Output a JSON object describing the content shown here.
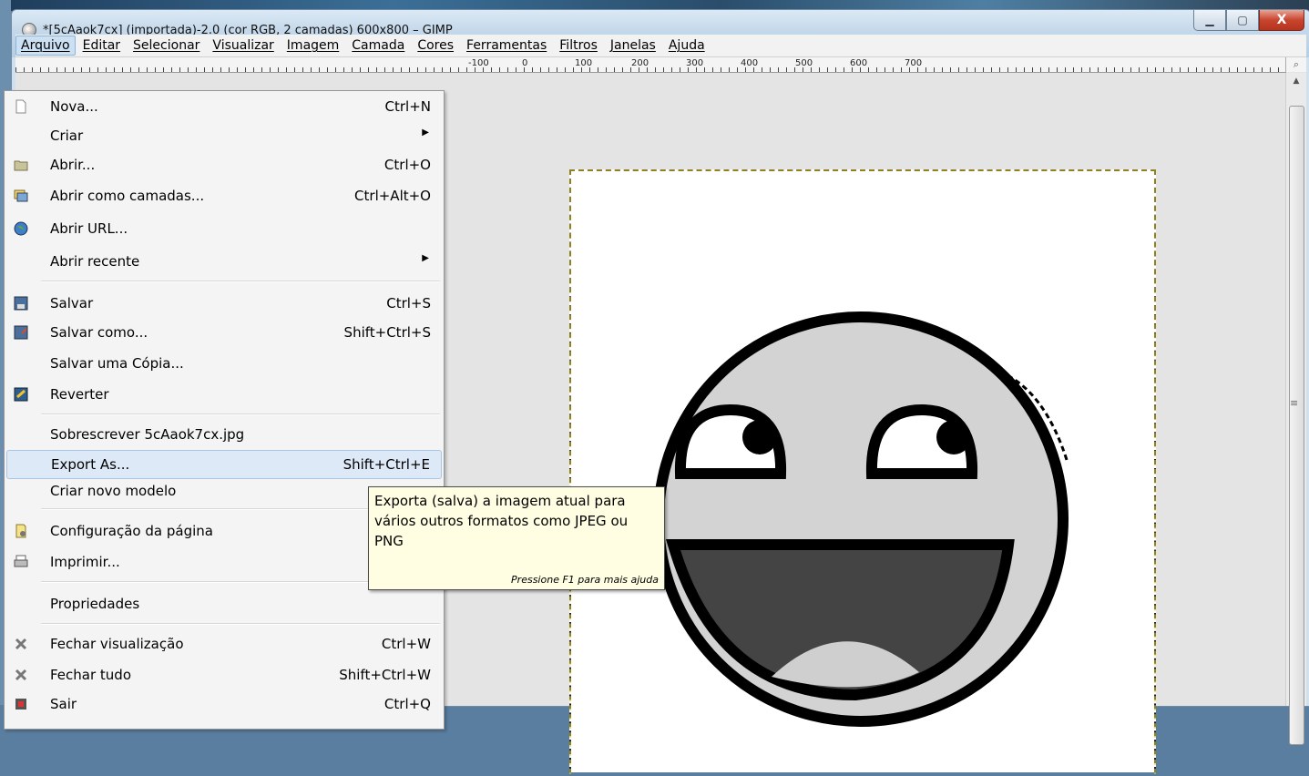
{
  "window": {
    "title": "*[5cAaok7cx] (importada)-2.0 (cor RGB, 2 camadas) 600x800 – GIMP",
    "controls": {
      "minimize": "▁",
      "maximize": "▢",
      "close": "X"
    }
  },
  "menubar": {
    "items": [
      "Arquivo",
      "Editar",
      "Selecionar",
      "Visualizar",
      "Imagem",
      "Camada",
      "Cores",
      "Ferramentas",
      "Filtros",
      "Janelas",
      "Ajuda"
    ],
    "active": "Arquivo"
  },
  "ruler": {
    "labels": [
      "-100",
      "0",
      "100",
      "200",
      "300",
      "400",
      "500",
      "600",
      "700"
    ]
  },
  "file_menu": {
    "items": [
      {
        "label": "Nova...",
        "shortcut": "Ctrl+N",
        "icon": "new-document-icon"
      },
      {
        "label": "Criar",
        "submenu": true
      },
      {
        "label": "Abrir...",
        "shortcut": "Ctrl+O",
        "icon": "folder-open-icon"
      },
      {
        "label": "Abrir como camadas...",
        "shortcut": "Ctrl+Alt+O",
        "icon": "open-as-layers-icon"
      },
      {
        "label": "Abrir URL...",
        "icon": "globe-icon"
      },
      {
        "label": "Abrir recente",
        "submenu": true
      },
      {
        "label": "Salvar",
        "shortcut": "Ctrl+S",
        "icon": "save-icon"
      },
      {
        "label": "Salvar como...",
        "shortcut": "Shift+Ctrl+S",
        "icon": "save-as-icon"
      },
      {
        "label": "Salvar uma Cópia..."
      },
      {
        "label": "Reverter",
        "icon": "revert-icon"
      },
      {
        "label": "Sobrescrever 5cAaok7cx.jpg"
      },
      {
        "label": "Export As...",
        "shortcut": "Shift+Ctrl+E",
        "highlighted": true
      },
      {
        "label": "Criar novo modelo"
      },
      {
        "label": "Configuração da página",
        "icon": "page-setup-icon"
      },
      {
        "label": "Imprimir...",
        "icon": "printer-icon"
      },
      {
        "label": "Propriedades"
      },
      {
        "label": "Fechar visualização",
        "shortcut": "Ctrl+W",
        "icon": "close-view-icon"
      },
      {
        "label": "Fechar tudo",
        "shortcut": "Shift+Ctrl+W",
        "icon": "close-all-icon"
      },
      {
        "label": "Sair",
        "shortcut": "Ctrl+Q",
        "icon": "quit-icon"
      }
    ]
  },
  "tooltip": {
    "text": "Exporta (salva) a imagem atual para vários outros formatos como JPEG ou PNG",
    "help": "Pressione F1 para mais ajuda"
  }
}
